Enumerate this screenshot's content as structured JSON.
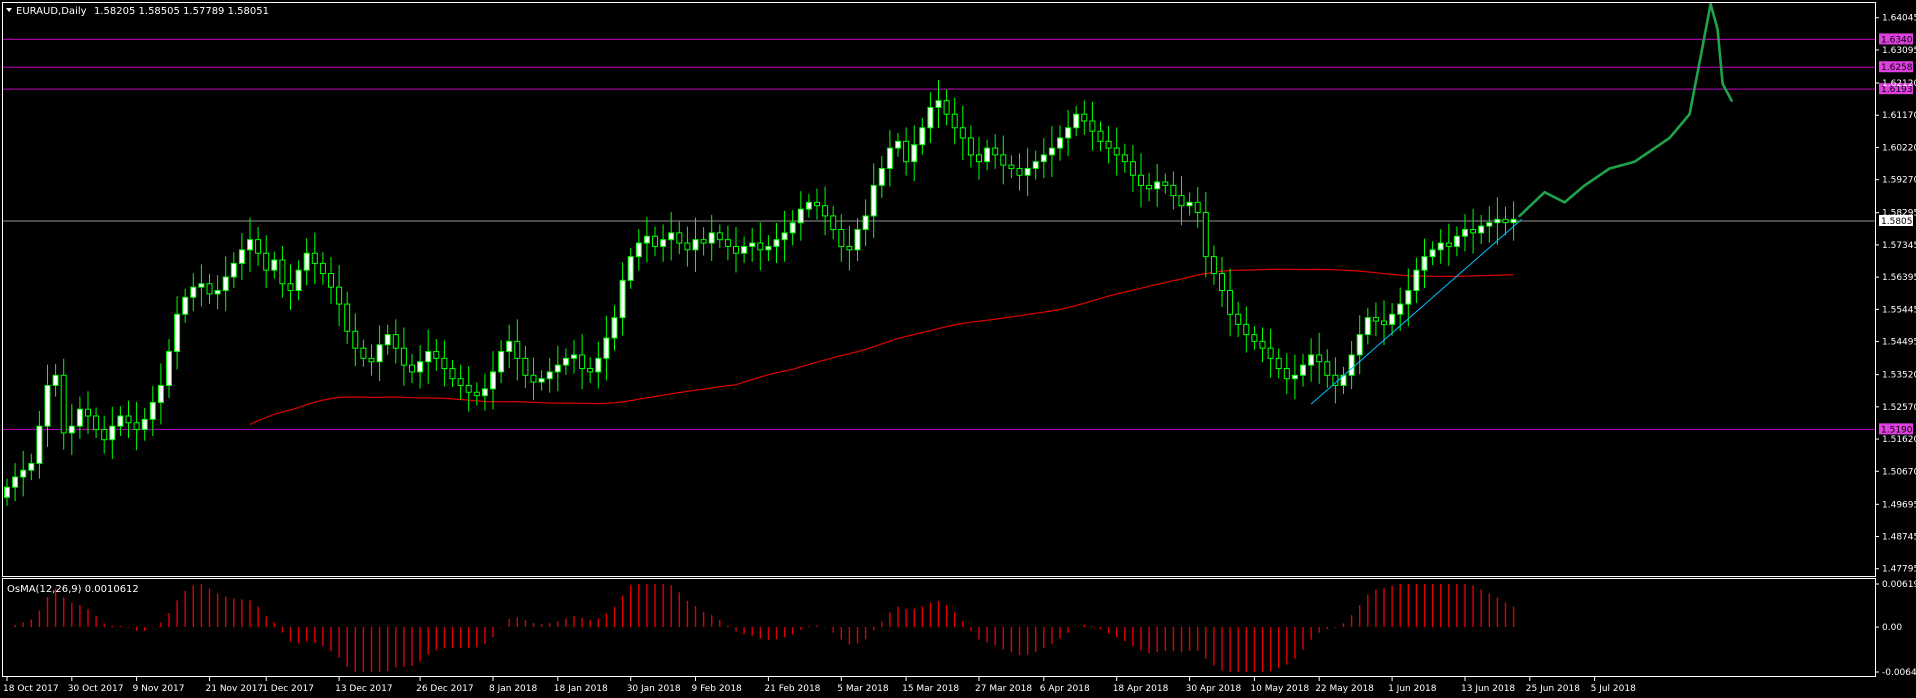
{
  "header": {
    "symbol": "EURAUD,Daily",
    "ohlc": "1.58205 1.58505 1.57789 1.58051"
  },
  "osma": {
    "label": "OsMA(12,26,9) 0.0010612",
    "axis_labels": [
      "0.006196",
      "0.00",
      "-0.006457"
    ]
  },
  "colors": {
    "background": "#000000",
    "frame": "#ffffff",
    "bull_candle": "#ffffff",
    "bear_candle": "#000000",
    "wick": "#00ff00",
    "level_line": "#c000c0",
    "level_tag": "#e040e0",
    "ma_line": "#e00000",
    "trend_line": "#00c0ff",
    "projection": "#1fa34a",
    "histogram": "#e00000",
    "price_line": "#c8c8c8"
  },
  "chart_data": {
    "type": "candlestick",
    "series": [
      {
        "name": "EURAUD,Daily",
        "kind": "candles"
      },
      {
        "name": "OsMA(12,26,9)",
        "kind": "histogram"
      }
    ],
    "y_axis_labels": [
      "1.64045",
      "1.63095",
      "1.62120",
      "1.61170",
      "1.60220",
      "1.59270",
      "1.58295",
      "1.57345",
      "1.56395",
      "1.55445",
      "1.54495",
      "1.53520",
      "1.52570",
      "1.51620",
      "1.50670",
      "1.49695",
      "1.48745",
      "1.47795"
    ],
    "ylim": [
      1.4764,
      1.6445
    ],
    "x_axis_labels": [
      "18 Oct 2017",
      "30 Oct 2017",
      "9 Nov 2017",
      "21 Nov 2017",
      "1 Dec 2017",
      "13 Dec 2017",
      "26 Dec 2017",
      "8 Jan 2018",
      "18 Jan 2018",
      "30 Jan 2018",
      "9 Feb 2018",
      "21 Feb 2018",
      "5 Mar 2018",
      "15 Mar 2018",
      "27 Mar 2018",
      "6 Apr 2018",
      "18 Apr 2018",
      "30 Apr 2018",
      "10 May 2018",
      "22 May 2018",
      "1 Jun 2018",
      "13 Jun 2018",
      "25 Jun 2018",
      "5 Jul 2018"
    ],
    "levels": [
      {
        "label": "1.63406",
        "value": 1.63406
      },
      {
        "label": "1.62585",
        "value": 1.62585
      },
      {
        "label": "1.61938",
        "value": 1.61938
      },
      {
        "label": "1.51905",
        "value": 1.51905
      }
    ],
    "current_price": {
      "label": "1.58051",
      "value": 1.58051
    },
    "close": [
      1.502,
      1.505,
      1.507,
      1.509,
      1.52,
      1.532,
      1.535,
      1.518,
      1.52,
      1.525,
      1.523,
      1.519,
      1.516,
      1.52,
      1.523,
      1.521,
      1.519,
      1.522,
      1.527,
      1.532,
      1.542,
      1.553,
      1.558,
      1.561,
      1.562,
      1.559,
      1.56,
      1.564,
      1.568,
      1.572,
      1.575,
      1.571,
      1.566,
      1.569,
      1.562,
      1.56,
      1.566,
      1.571,
      1.568,
      1.565,
      1.561,
      1.556,
      1.548,
      1.543,
      1.54,
      1.539,
      1.544,
      1.547,
      1.543,
      1.538,
      1.536,
      1.539,
      1.542,
      1.54,
      1.537,
      1.534,
      1.532,
      1.53,
      1.529,
      1.531,
      1.536,
      1.542,
      1.545,
      1.54,
      1.535,
      1.533,
      1.534,
      1.536,
      1.538,
      1.54,
      1.541,
      1.537,
      1.536,
      1.54,
      1.546,
      1.552,
      1.563,
      1.57,
      1.574,
      1.576,
      1.573,
      1.575,
      1.577,
      1.574,
      1.572,
      1.575,
      1.574,
      1.577,
      1.575,
      1.573,
      1.571,
      1.573,
      1.574,
      1.572,
      1.573,
      1.575,
      1.577,
      1.58,
      1.584,
      1.586,
      1.585,
      1.582,
      1.578,
      1.573,
      1.572,
      1.578,
      1.582,
      1.591,
      1.596,
      1.602,
      1.604,
      1.598,
      1.603,
      1.608,
      1.614,
      1.616,
      1.612,
      1.608,
      1.605,
      1.6,
      1.598,
      1.602,
      1.6,
      1.597,
      1.596,
      1.594,
      1.596,
      1.598,
      1.6,
      1.602,
      1.605,
      1.608,
      1.612,
      1.61,
      1.607,
      1.604,
      1.602,
      1.6,
      1.598,
      1.594,
      1.591,
      1.59,
      1.592,
      1.591,
      1.588,
      1.585,
      1.586,
      1.583,
      1.57,
      1.565,
      1.56,
      1.553,
      1.55,
      1.547,
      1.545,
      1.543,
      1.54,
      1.537,
      1.534,
      1.535,
      1.538,
      1.541,
      1.539,
      1.535,
      1.532,
      1.535,
      1.541,
      1.547,
      1.552,
      1.551,
      1.55,
      1.553,
      1.556,
      1.56,
      1.566,
      1.57,
      1.572,
      1.574,
      1.573,
      1.576,
      1.578,
      1.577,
      1.579,
      1.58,
      1.581,
      1.58,
      1.581
    ]
  }
}
